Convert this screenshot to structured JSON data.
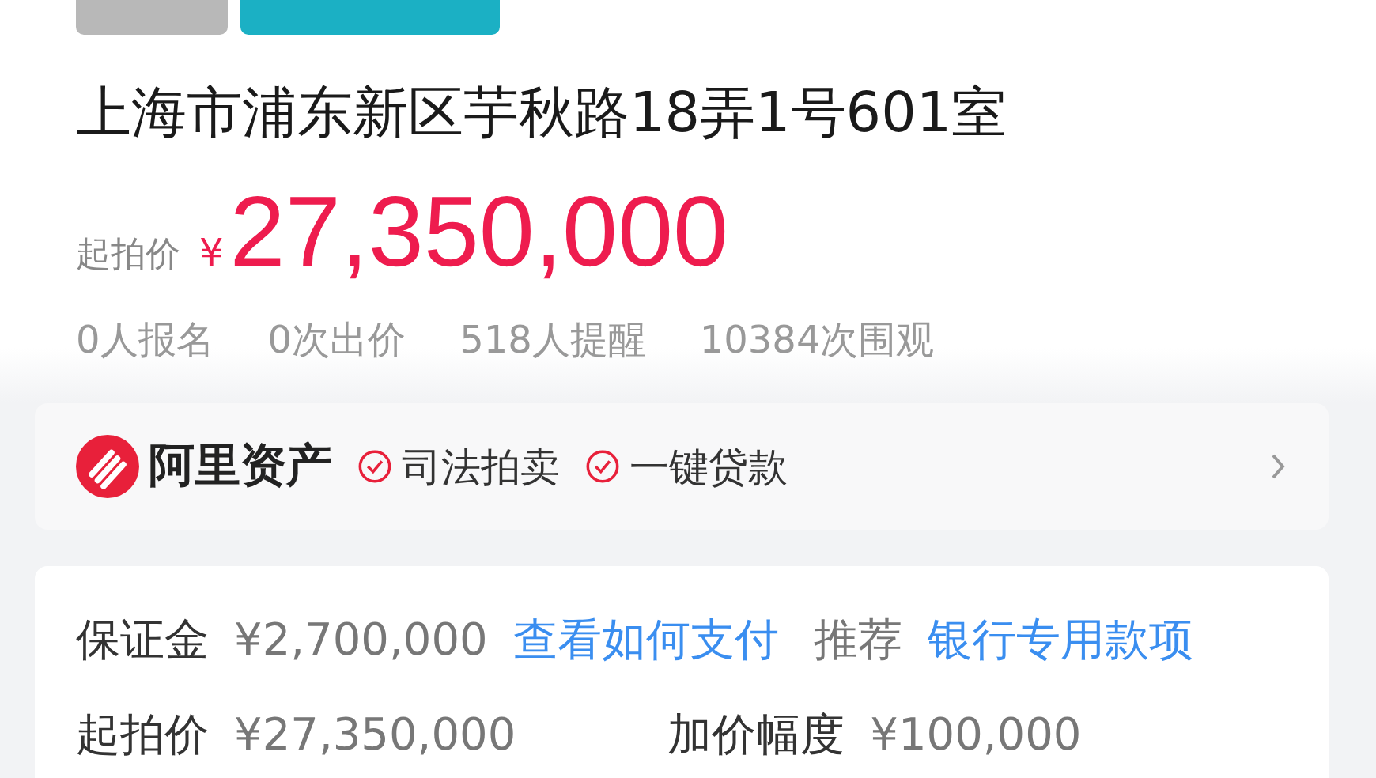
{
  "status": {
    "badges": [
      {
        "kind": "type"
      },
      {
        "kind": "status"
      }
    ]
  },
  "title": "上海市浦东新区芋秋路18弄1号601室",
  "price": {
    "label": "起拍价",
    "currency": "¥",
    "value": "27,350,000"
  },
  "stats": [
    "0人报名",
    "0次出价",
    "518人提醒",
    "10384次围观"
  ],
  "platform": {
    "name": "阿里资产",
    "features": [
      "司法拍卖",
      "一键贷款"
    ]
  },
  "details": [
    {
      "label": "保证金",
      "value": "¥2,700,000",
      "link": "查看如何支付",
      "note": "推荐",
      "note_link": "银行专用款项"
    },
    {
      "label": "起拍价",
      "value": "¥27,350,000",
      "label_2": "加价幅度",
      "value_2": "¥100,000"
    }
  ]
}
